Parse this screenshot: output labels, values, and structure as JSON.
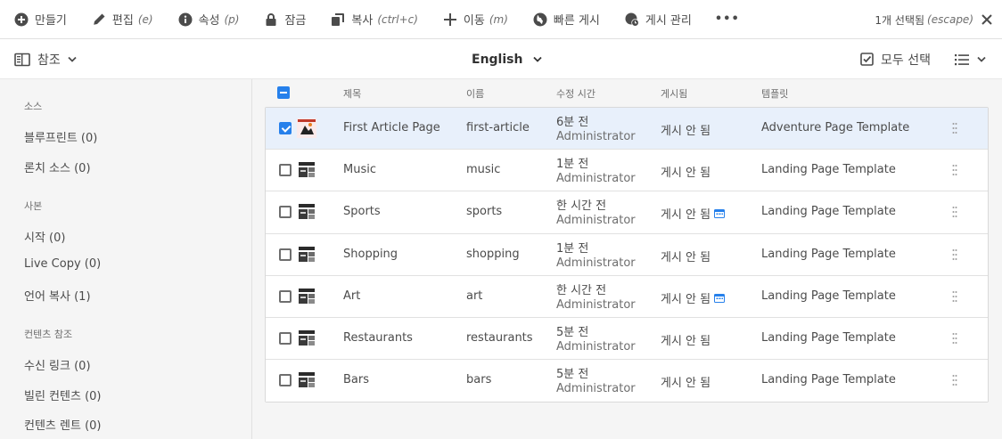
{
  "toolbar": {
    "actions": [
      {
        "label": "만들기",
        "hint": "",
        "icon": "add-circle-icon"
      },
      {
        "label": "편집",
        "hint": "(e)",
        "icon": "pencil-icon"
      },
      {
        "label": "속성",
        "hint": "(p)",
        "icon": "info-icon"
      },
      {
        "label": "잠금",
        "hint": "",
        "icon": "lock-icon"
      },
      {
        "label": "복사",
        "hint": "(ctrl+c)",
        "icon": "copy-icon"
      },
      {
        "label": "이동",
        "hint": "(m)",
        "icon": "move-icon"
      },
      {
        "label": "빠른 게시",
        "hint": "",
        "icon": "globe-icon"
      },
      {
        "label": "게시 관리",
        "hint": "",
        "icon": "globe-clock-icon"
      }
    ],
    "more_label": "•••",
    "selection_count": "1개 선택됨",
    "selection_hint": "(escape)"
  },
  "subbar": {
    "rail_label": "참조",
    "language": "English",
    "select_all_label": "모두 선택"
  },
  "rail": {
    "sections": [
      {
        "heading": "소스",
        "items": [
          "블루프린트 (0)",
          "론치 소스 (0)"
        ]
      },
      {
        "heading": "사본",
        "items": [
          "시작 (0)",
          "Live Copy (0)",
          "언어 복사 (1)"
        ]
      },
      {
        "heading": "컨텐츠 참조",
        "items": [
          "수신 링크 (0)",
          "빌린 컨텐츠 (0)",
          "컨텐츠 렌트 (0)"
        ]
      }
    ]
  },
  "table": {
    "headers": {
      "title": "제목",
      "name": "이름",
      "modified": "수정 시간",
      "published": "게시됨",
      "template": "템플릿"
    },
    "rows": [
      {
        "title": "First Article Page",
        "name": "first-article",
        "modified": "6분 전",
        "modified_by": "Administrator",
        "published": "게시 안 됨",
        "scheduled": false,
        "template": "Adventure Page Template",
        "selected": true
      },
      {
        "title": "Music",
        "name": "music",
        "modified": "1분 전",
        "modified_by": "Administrator",
        "published": "게시 안 됨",
        "scheduled": false,
        "template": "Landing Page Template",
        "selected": false
      },
      {
        "title": "Sports",
        "name": "sports",
        "modified": "한 시간 전",
        "modified_by": "Administrator",
        "published": "게시 안 됨",
        "scheduled": true,
        "template": "Landing Page Template",
        "selected": false
      },
      {
        "title": "Shopping",
        "name": "shopping",
        "modified": "1분 전",
        "modified_by": "Administrator",
        "published": "게시 안 됨",
        "scheduled": false,
        "template": "Landing Page Template",
        "selected": false
      },
      {
        "title": "Art",
        "name": "art",
        "modified": "한 시간 전",
        "modified_by": "Administrator",
        "published": "게시 안 됨",
        "scheduled": true,
        "template": "Landing Page Template",
        "selected": false
      },
      {
        "title": "Restaurants",
        "name": "restaurants",
        "modified": "5분 전",
        "modified_by": "Administrator",
        "published": "게시 안 됨",
        "scheduled": false,
        "template": "Landing Page Template",
        "selected": false
      },
      {
        "title": "Bars",
        "name": "bars",
        "modified": "5분 전",
        "modified_by": "Administrator",
        "published": "게시 안 됨",
        "scheduled": false,
        "template": "Landing Page Template",
        "selected": false
      }
    ]
  },
  "colors": {
    "accent": "#2680eb",
    "selected_row": "#e8f0fb",
    "rail_bg": "#f5f5f5"
  }
}
